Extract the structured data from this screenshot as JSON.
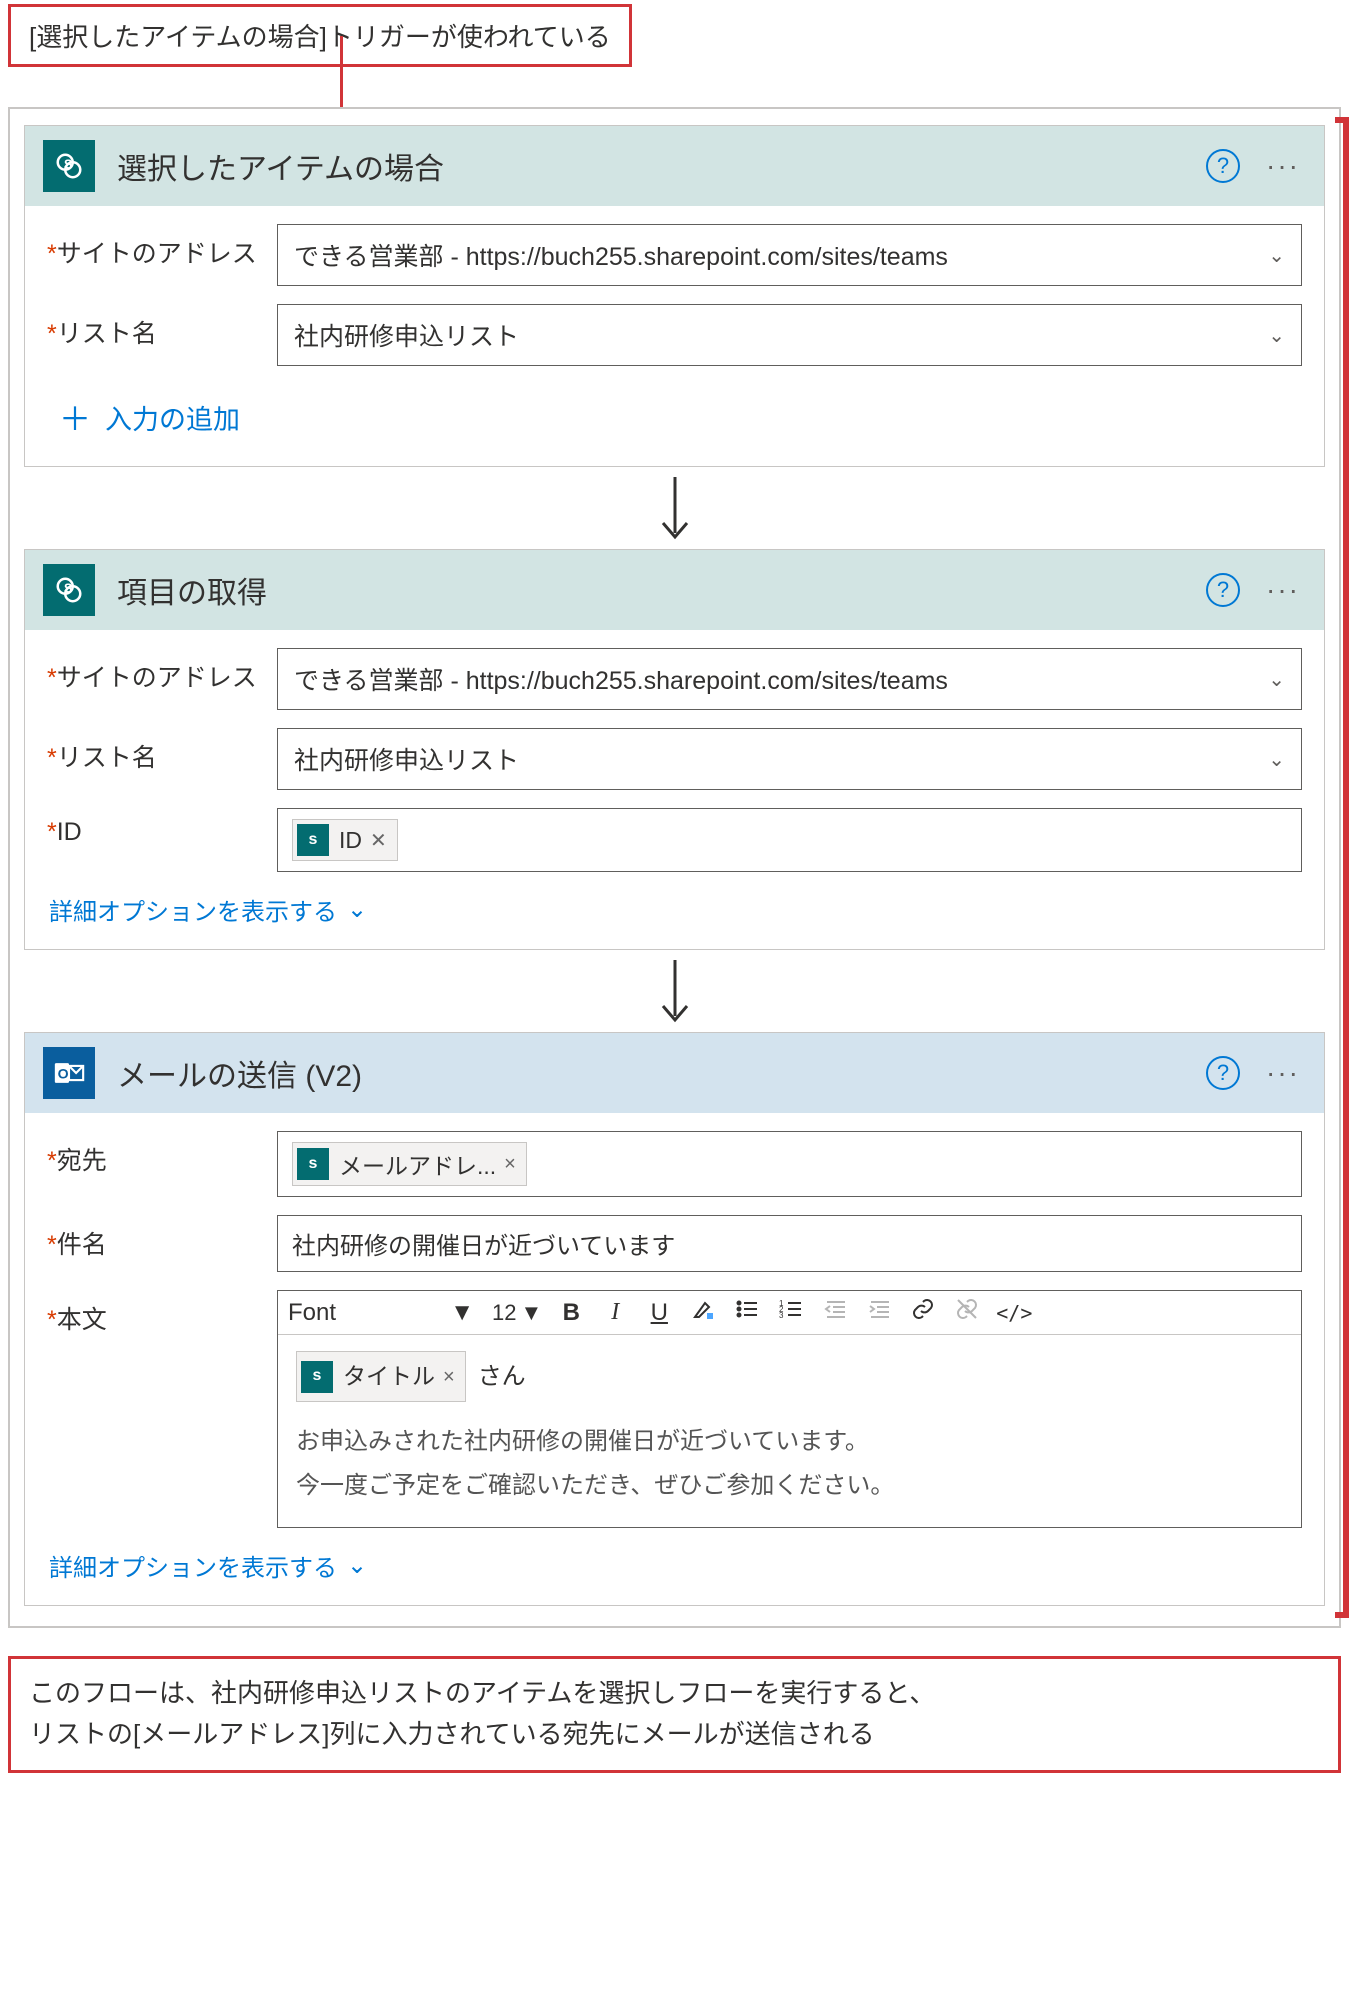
{
  "callout_top": "[選択したアイテムの場合]トリガーが使われている",
  "callout_bottom_line1": "このフローは、社内研修申込リストのアイテムを選択しフローを実行すると、",
  "callout_bottom_line2": "リストの[メールアドレス]列に入力されている宛先にメールが送信される",
  "cards": {
    "trigger": {
      "title": "選択したアイテムの場合",
      "fields": {
        "site_label": "サイトのアドレス",
        "site_value": "できる営業部 - https://buch255.sharepoint.com/sites/teams",
        "list_label": "リスト名",
        "list_value": "社内研修申込リスト"
      },
      "add_input": "入力の追加"
    },
    "getitem": {
      "title": "項目の取得",
      "fields": {
        "site_label": "サイトのアドレス",
        "site_value": "できる営業部 - https://buch255.sharepoint.com/sites/teams",
        "list_label": "リスト名",
        "list_value": "社内研修申込リスト",
        "id_label": "ID",
        "id_token": "ID"
      },
      "advanced": "詳細オプションを表示する"
    },
    "mail": {
      "title": "メールの送信 (V2)",
      "fields": {
        "to_label": "宛先",
        "to_token": "メールアドレ...",
        "subject_label": "件名",
        "subject_value": "社内研修の開催日が近づいています",
        "body_label": "本文",
        "body_token": "タイトル",
        "body_after_token": "さん",
        "body_text1": "お申込みされた社内研修の開催日が近づいています。",
        "body_text2": "今一度ご予定をご確認いただき、ぜひご参加ください。"
      },
      "rte": {
        "font": "Font",
        "size": "12"
      },
      "advanced": "詳細オプションを表示する"
    }
  },
  "icons": {
    "help": "?",
    "menu": "···",
    "plus": "＋",
    "remove": "×",
    "remove_alt": "✕"
  }
}
